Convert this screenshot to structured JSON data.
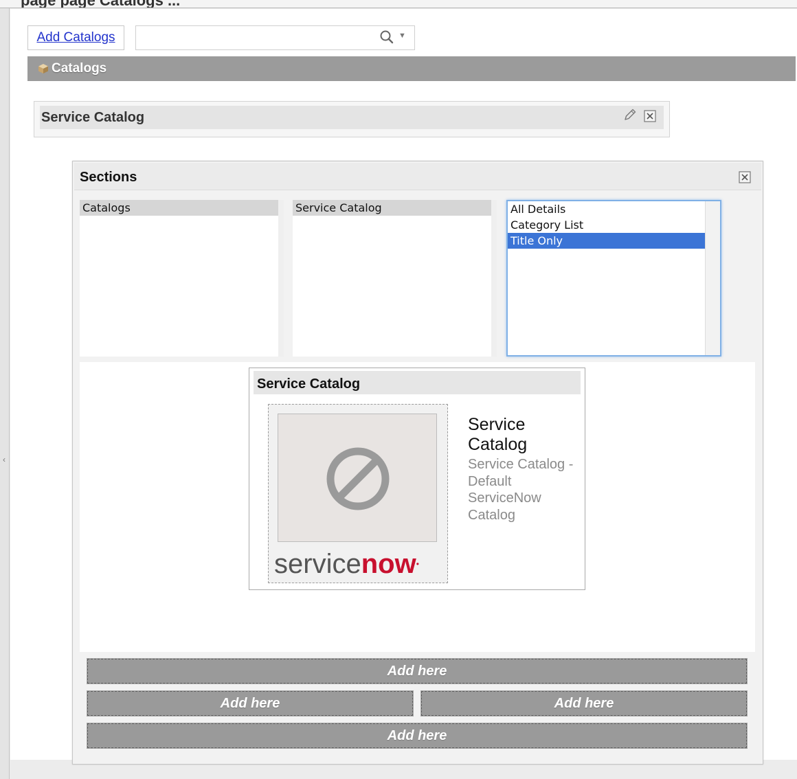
{
  "top_bar": {
    "clipped_text": "page  page  Catalogs  ..."
  },
  "toolbar": {
    "add_label": "Add Catalogs",
    "search": {
      "value": "",
      "icon": "search-icon",
      "dropdown_icon": "chevron-down-icon"
    }
  },
  "catalogs_header": {
    "title": "Catalogs",
    "icon": "cube-icon"
  },
  "catalog_item": {
    "title": "Service Catalog",
    "icons": [
      "pencil-icon",
      "close-icon"
    ]
  },
  "sections": {
    "title": "Sections",
    "lists": [
      {
        "options": [
          "Catalogs"
        ],
        "selected": "Catalogs"
      },
      {
        "options": [
          "Service Catalog"
        ],
        "selected": "Service Catalog"
      },
      {
        "options": [
          "All Details",
          "Category List",
          "Title Only"
        ],
        "selected": "Title Only"
      }
    ],
    "preview": {
      "header": "Service Catalog",
      "name": "Service Catalog",
      "description": "Service Catalog - Default ServiceNow Catalog",
      "logo_part1": "service",
      "logo_part2": "now",
      "logo_mark": "•"
    },
    "drop_zones": [
      "Add here",
      "Add here",
      "Add here",
      "Add here"
    ]
  },
  "colors": {
    "header_gray": "#9b9b9b",
    "link_blue": "#2233cc",
    "selection_blue": "#3b74d6",
    "brand_red": "#c8102e",
    "drop_gray": "#9a9a9a"
  }
}
